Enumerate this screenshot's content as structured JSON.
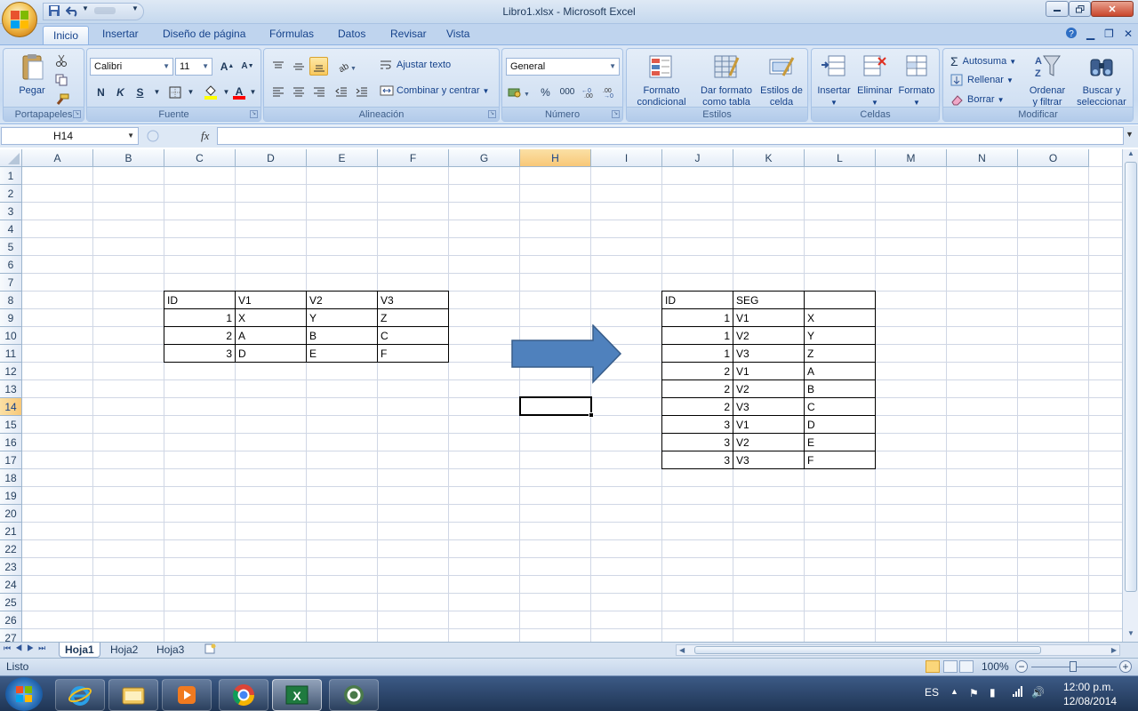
{
  "window": {
    "title": "Libro1.xlsx - Microsoft Excel"
  },
  "ribbon": {
    "tabs": [
      "Inicio",
      "Insertar",
      "Diseño de página",
      "Fórmulas",
      "Datos",
      "Revisar",
      "Vista"
    ],
    "clipboard": {
      "label": "Portapapeles",
      "paste": "Pegar"
    },
    "font": {
      "label": "Fuente",
      "family": "Calibri",
      "size": "11",
      "bold": "N",
      "italic": "K",
      "underline": "S"
    },
    "alignment": {
      "label": "Alineación",
      "wrap": "Ajustar texto",
      "merge": "Combinar y centrar"
    },
    "number": {
      "label": "Número",
      "format": "General",
      "percent": "%",
      "thousands": "000"
    },
    "styles": {
      "label": "Estilos",
      "conditional_1": "Formato",
      "conditional_2": "condicional",
      "table_1": "Dar formato",
      "table_2": "como tabla",
      "cell_1": "Estilos de",
      "cell_2": "celda"
    },
    "cells": {
      "label": "Celdas",
      "insert": "Insertar",
      "delete": "Eliminar",
      "format": "Formato"
    },
    "editing": {
      "label": "Modificar",
      "autosum": "Autosuma",
      "fill": "Rellenar",
      "clear": "Borrar",
      "sort_1": "Ordenar",
      "sort_2": "y filtrar",
      "find_1": "Buscar y",
      "find_2": "seleccionar"
    }
  },
  "formula_bar": {
    "name_box": "H14",
    "fx": "fx",
    "value": ""
  },
  "columns": [
    "A",
    "B",
    "C",
    "D",
    "E",
    "F",
    "G",
    "H",
    "I",
    "J",
    "K",
    "L",
    "M",
    "N",
    "O"
  ],
  "rows": [
    "1",
    "2",
    "3",
    "4",
    "5",
    "6",
    "7",
    "8",
    "9",
    "10",
    "11",
    "12",
    "13",
    "14",
    "15",
    "16",
    "17",
    "18",
    "19",
    "20",
    "21",
    "22",
    "23",
    "24",
    "25",
    "26",
    "27"
  ],
  "selected_cell": "H14",
  "source_table": {
    "header": [
      "ID",
      "V1",
      "V2",
      "V3"
    ],
    "rows": [
      [
        "1",
        "X",
        "Y",
        "Z"
      ],
      [
        "2",
        "A",
        "B",
        "C"
      ],
      [
        "3",
        "D",
        "E",
        "F"
      ]
    ]
  },
  "result_table": {
    "header": [
      "ID",
      "SEG",
      ""
    ],
    "rows": [
      [
        "1",
        "V1",
        "X"
      ],
      [
        "1",
        "V2",
        "Y"
      ],
      [
        "1",
        "V3",
        "Z"
      ],
      [
        "2",
        "V1",
        "A"
      ],
      [
        "2",
        "V2",
        "B"
      ],
      [
        "2",
        "V3",
        "C"
      ],
      [
        "3",
        "V1",
        "D"
      ],
      [
        "3",
        "V2",
        "E"
      ],
      [
        "3",
        "V3",
        "F"
      ]
    ]
  },
  "arrow_color": "#4f81bd",
  "sheets": [
    "Hoja1",
    "Hoja2",
    "Hoja3"
  ],
  "status": {
    "ready": "Listo",
    "zoom": "100%"
  },
  "taskbar": {
    "lang": "ES",
    "time": "12:00 p.m.",
    "date": "12/08/2014"
  }
}
